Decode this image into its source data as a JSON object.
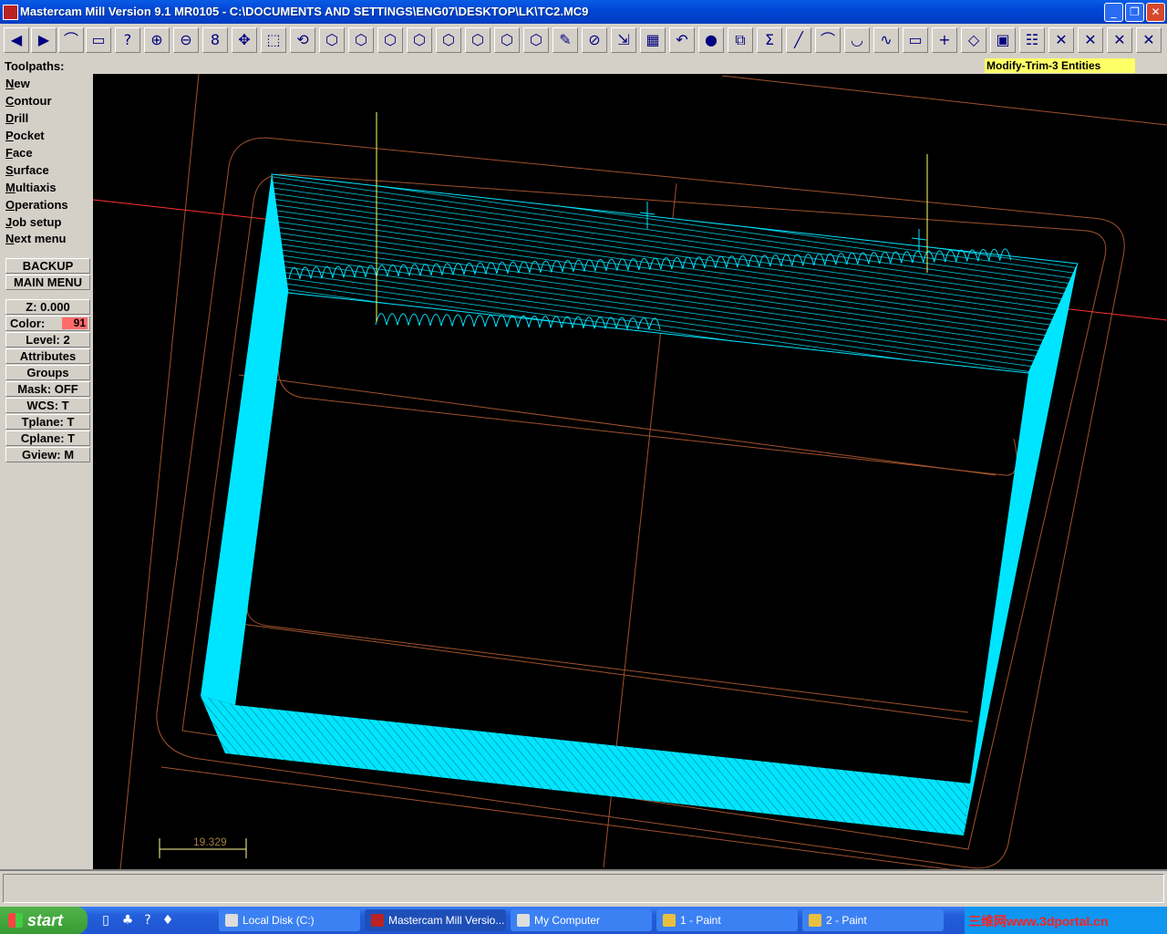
{
  "window": {
    "title": "Mastercam Mill Version 9.1 MR0105 - C:\\DOCUMENTS AND SETTINGS\\ENG07\\DESKTOP\\LK\\TC2.MC9",
    "minimize": "_",
    "restore": "❐",
    "close": "✕"
  },
  "toolbar": {
    "buttons": [
      {
        "icon": "arrow-left-icon",
        "glyph": "◀"
      },
      {
        "icon": "arrow-right-icon",
        "glyph": "▶"
      },
      {
        "icon": "chain-icon",
        "glyph": "⌒"
      },
      {
        "icon": "eraser-icon",
        "glyph": "▭"
      },
      {
        "icon": "analyze-icon",
        "glyph": "?"
      },
      {
        "icon": "zoom-icon",
        "glyph": "⊕"
      },
      {
        "icon": "unzoom-icon",
        "glyph": "⊖"
      },
      {
        "icon": "zoom-08-icon",
        "glyph": "8"
      },
      {
        "icon": "pan-icon",
        "glyph": "✥"
      },
      {
        "icon": "zoom-window-icon",
        "glyph": "⬚"
      },
      {
        "icon": "rotate-icon",
        "glyph": "⟲"
      },
      {
        "icon": "view-top-icon",
        "glyph": "⬡"
      },
      {
        "icon": "view-front-icon",
        "glyph": "⬡"
      },
      {
        "icon": "view-side-icon",
        "glyph": "⬡"
      },
      {
        "icon": "view-iso-icon",
        "glyph": "⬡"
      },
      {
        "icon": "cplane-top-icon",
        "glyph": "⬡"
      },
      {
        "icon": "cplane-front-icon",
        "glyph": "⬡"
      },
      {
        "icon": "cplane-side-icon",
        "glyph": "⬡"
      },
      {
        "icon": "cplane-3d-icon",
        "glyph": "⬡"
      },
      {
        "icon": "pencil-icon",
        "glyph": "✎"
      },
      {
        "icon": "no-delete-icon",
        "glyph": "⊘"
      },
      {
        "icon": "transform-icon",
        "glyph": "⇲"
      },
      {
        "icon": "colors-icon",
        "glyph": "▦"
      },
      {
        "icon": "undo-icon",
        "glyph": "↶"
      },
      {
        "icon": "sphere-icon",
        "glyph": "●"
      },
      {
        "icon": "stack-icon",
        "glyph": "⧉"
      },
      {
        "icon": "sigma-icon",
        "glyph": "Σ"
      },
      {
        "icon": "line-icon",
        "glyph": "╱"
      },
      {
        "icon": "arc-icon",
        "glyph": "⌒"
      },
      {
        "icon": "fillet-icon",
        "glyph": "◡"
      },
      {
        "icon": "spline-icon",
        "glyph": "∿"
      },
      {
        "icon": "rectangle-icon",
        "glyph": "▭"
      },
      {
        "icon": "point-icon",
        "glyph": "+"
      },
      {
        "icon": "surface-icon",
        "glyph": "◇"
      },
      {
        "icon": "solid-box-icon",
        "glyph": "▣"
      },
      {
        "icon": "ladder-icon",
        "glyph": "☷"
      },
      {
        "icon": "trim-1-icon",
        "glyph": "✕"
      },
      {
        "icon": "trim-2-icon",
        "glyph": "✕"
      },
      {
        "icon": "trim-3-icon",
        "glyph": "✕"
      },
      {
        "icon": "trim-divide-icon",
        "glyph": "✕"
      }
    ]
  },
  "prompt": {
    "label": "Toolpaths:",
    "message": "Modify-Trim-3 Entities"
  },
  "menu": {
    "items": [
      {
        "hot": "N",
        "rest": "ew"
      },
      {
        "hot": "C",
        "rest": "ontour"
      },
      {
        "hot": "D",
        "rest": "rill"
      },
      {
        "hot": "P",
        "rest": "ocket"
      },
      {
        "hot": "F",
        "rest": "ace"
      },
      {
        "hot": "S",
        "rest": "urface"
      },
      {
        "hot": "M",
        "rest": "ultiaxis"
      },
      {
        "hot": "O",
        "rest": "perations"
      },
      {
        "hot": "J",
        "rest": "ob setup"
      },
      {
        "hot": "N",
        "rest": "ext menu"
      }
    ],
    "backup": "BACKUP",
    "main_menu": "MAIN MENU"
  },
  "status": {
    "z": "Z:  0.000",
    "color_label": "Color:",
    "color_value": "91",
    "level": "Level:  2",
    "attributes": "Attributes",
    "groups": "Groups",
    "mask": "Mask:  OFF",
    "wcs": "WCS:   T",
    "tplane": "Tplane:  T",
    "cplane": "Cplane:  T",
    "gview": "Gview:   M"
  },
  "viewport": {
    "scale_label": "19.329",
    "colors": {
      "background": "#000000",
      "wire": "#a0522d",
      "toolpath": "#00e5ff",
      "crosshair": "#ff3030",
      "axis": "#ffff66"
    }
  },
  "taskbar": {
    "start": "start",
    "tasks": [
      "Local Disk (C:)",
      "Mastercam Mill Versio...",
      "My Computer",
      "1 - Paint",
      "2 - Paint"
    ],
    "watermark": "三维网www.3dportal.cn"
  }
}
